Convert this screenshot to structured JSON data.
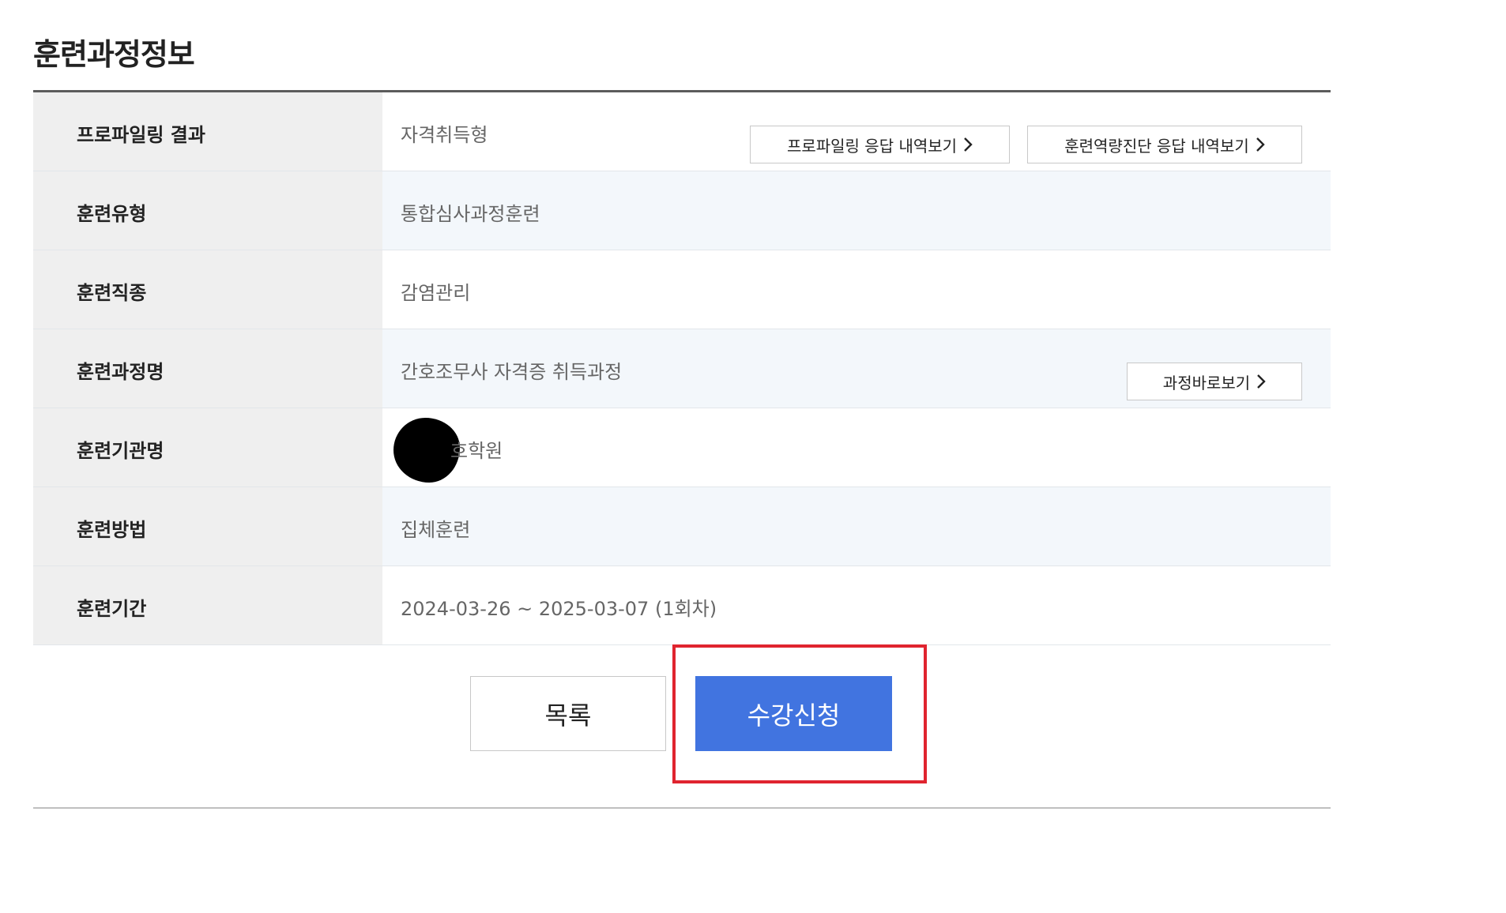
{
  "section": {
    "title": "훈련과정정보"
  },
  "rows": [
    {
      "label": "프로파일링 결과",
      "value": "자격취득형"
    },
    {
      "label": "훈련유형",
      "value": "통합심사과정훈련"
    },
    {
      "label": "훈련직종",
      "value": "감염관리"
    },
    {
      "label": "훈련과정명",
      "value": "간호조무사 자격증 취득과정"
    },
    {
      "label": "훈련기관명",
      "value": "호학원"
    },
    {
      "label": "훈련방법",
      "value": "집체훈련"
    },
    {
      "label": "훈련기간",
      "value": "2024-03-26 ~ 2025-03-07 (1회차)"
    }
  ],
  "links": {
    "profiling_response": "프로파일링 응답 내역보기",
    "competency_response": "훈련역량진단 응답 내역보기",
    "course_direct": "과정바로보기"
  },
  "buttons": {
    "list": "목록",
    "apply": "수강신청"
  },
  "colors": {
    "apply_button": "#4174e0",
    "highlight_border": "#e0242f",
    "label_background": "#efefef",
    "shaded_row": "#f3f7fb"
  }
}
